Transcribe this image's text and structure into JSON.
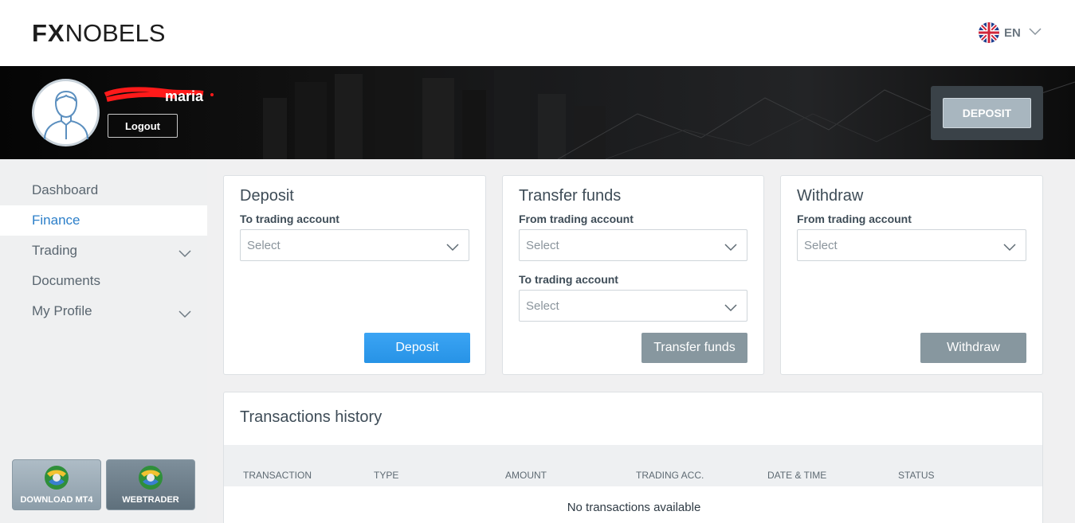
{
  "brand": {
    "logo_bold": "FX",
    "logo_light": "NOBELS"
  },
  "language": {
    "code": "EN",
    "flag_icon": "uk-flag-icon"
  },
  "user": {
    "name": "maria",
    "logout_label": "Logout"
  },
  "header": {
    "deposit_label": "DEPOSIT"
  },
  "sidebar": {
    "items": [
      {
        "label": "Dashboard",
        "active": false,
        "expandable": false
      },
      {
        "label": "Finance",
        "active": true,
        "expandable": false
      },
      {
        "label": "Trading",
        "active": false,
        "expandable": true
      },
      {
        "label": "Documents",
        "active": false,
        "expandable": false
      },
      {
        "label": "My Profile",
        "active": false,
        "expandable": true
      }
    ],
    "platforms": {
      "mt4_label": "DOWNLOAD MT4",
      "web_label": "WEBTRADER"
    }
  },
  "cards": {
    "deposit": {
      "title": "Deposit",
      "field_label": "To trading account",
      "select_value": "Select",
      "button_label": "Deposit"
    },
    "transfer": {
      "title": "Transfer funds",
      "from_label": "From trading account",
      "from_value": "Select",
      "to_label": "To trading account",
      "to_value": "Select",
      "button_label": "Transfer funds"
    },
    "withdraw": {
      "title": "Withdraw",
      "field_label": "From trading account",
      "select_value": "Select",
      "button_label": "Withdraw"
    }
  },
  "transactions": {
    "title": "Transactions history",
    "columns": [
      "TRANSACTION",
      "TYPE",
      "AMOUNT",
      "TRADING ACC.",
      "DATE & TIME",
      "STATUS"
    ],
    "empty_message": "No transactions available"
  },
  "colors": {
    "accent_blue": "#2c7fc9",
    "primary_button": "#2793e6",
    "secondary_button": "#87979f",
    "hero_dark": "#0c0c0c"
  }
}
